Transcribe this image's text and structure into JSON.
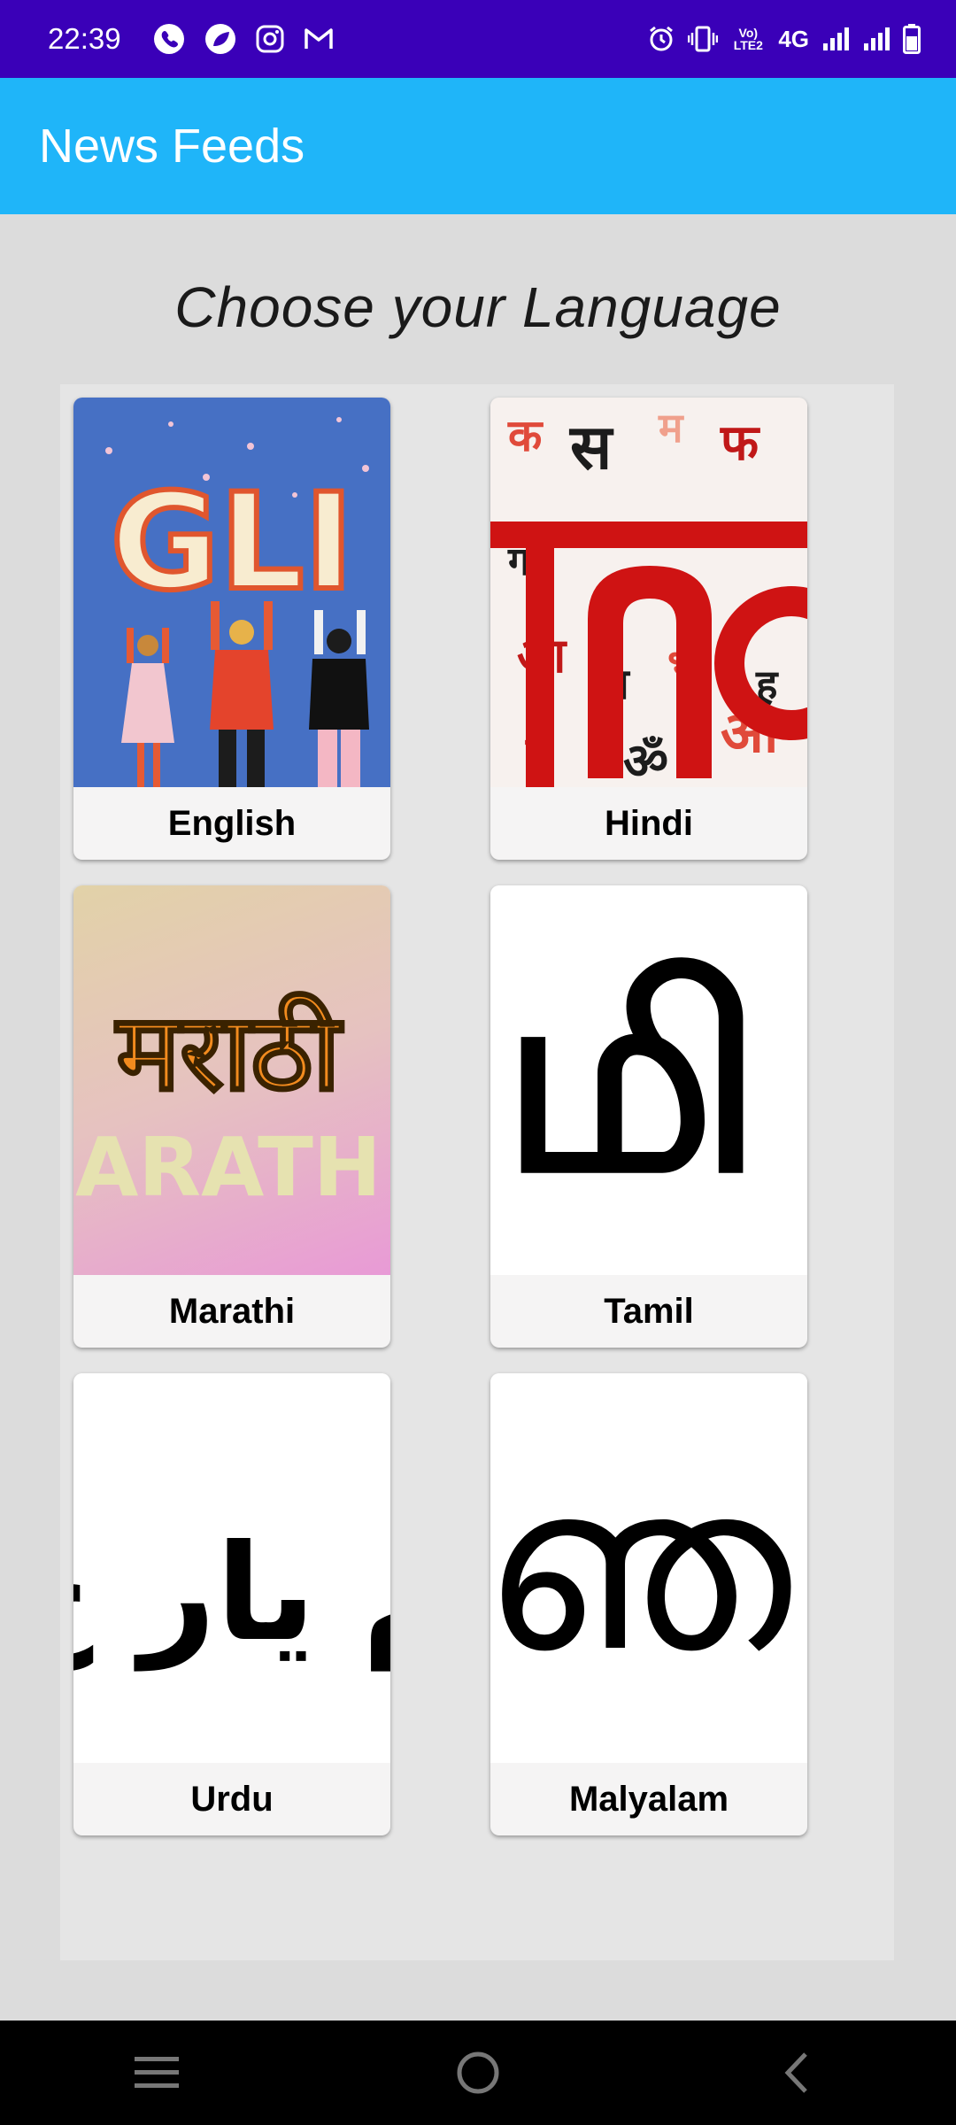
{
  "status_bar": {
    "time": "22:39",
    "network_type": "4G",
    "volte_label": "Vo) LTE2",
    "icons": [
      "phone-icon",
      "leaf-app-icon",
      "instagram-icon",
      "gmail-icon",
      "alarm-icon",
      "vibrate-icon",
      "volte-icon",
      "signal-icon",
      "signal-icon",
      "battery-icon"
    ]
  },
  "app_bar": {
    "title": "News Feeds",
    "color": "#1fb5f9"
  },
  "heading": "Choose your Language",
  "languages": [
    {
      "label": "English"
    },
    {
      "label": "Hindi"
    },
    {
      "label": "Marathi"
    },
    {
      "label": "Tamil"
    },
    {
      "label": "Urdu"
    },
    {
      "label": "Malyalam"
    }
  ],
  "thumbnails": {
    "english_text": "GLI",
    "marathi_top": "मराठी",
    "marathi_bottom": "ARATH",
    "tamil_text": "மி",
    "urdu_text": "م یار خ",
    "malayalam_text": "ഞ"
  },
  "nav_bar": {
    "icons": [
      "menu-icon",
      "home-icon",
      "back-icon"
    ]
  },
  "colors": {
    "status_bar": "#3a00b8",
    "background": "#dcdcdc"
  }
}
